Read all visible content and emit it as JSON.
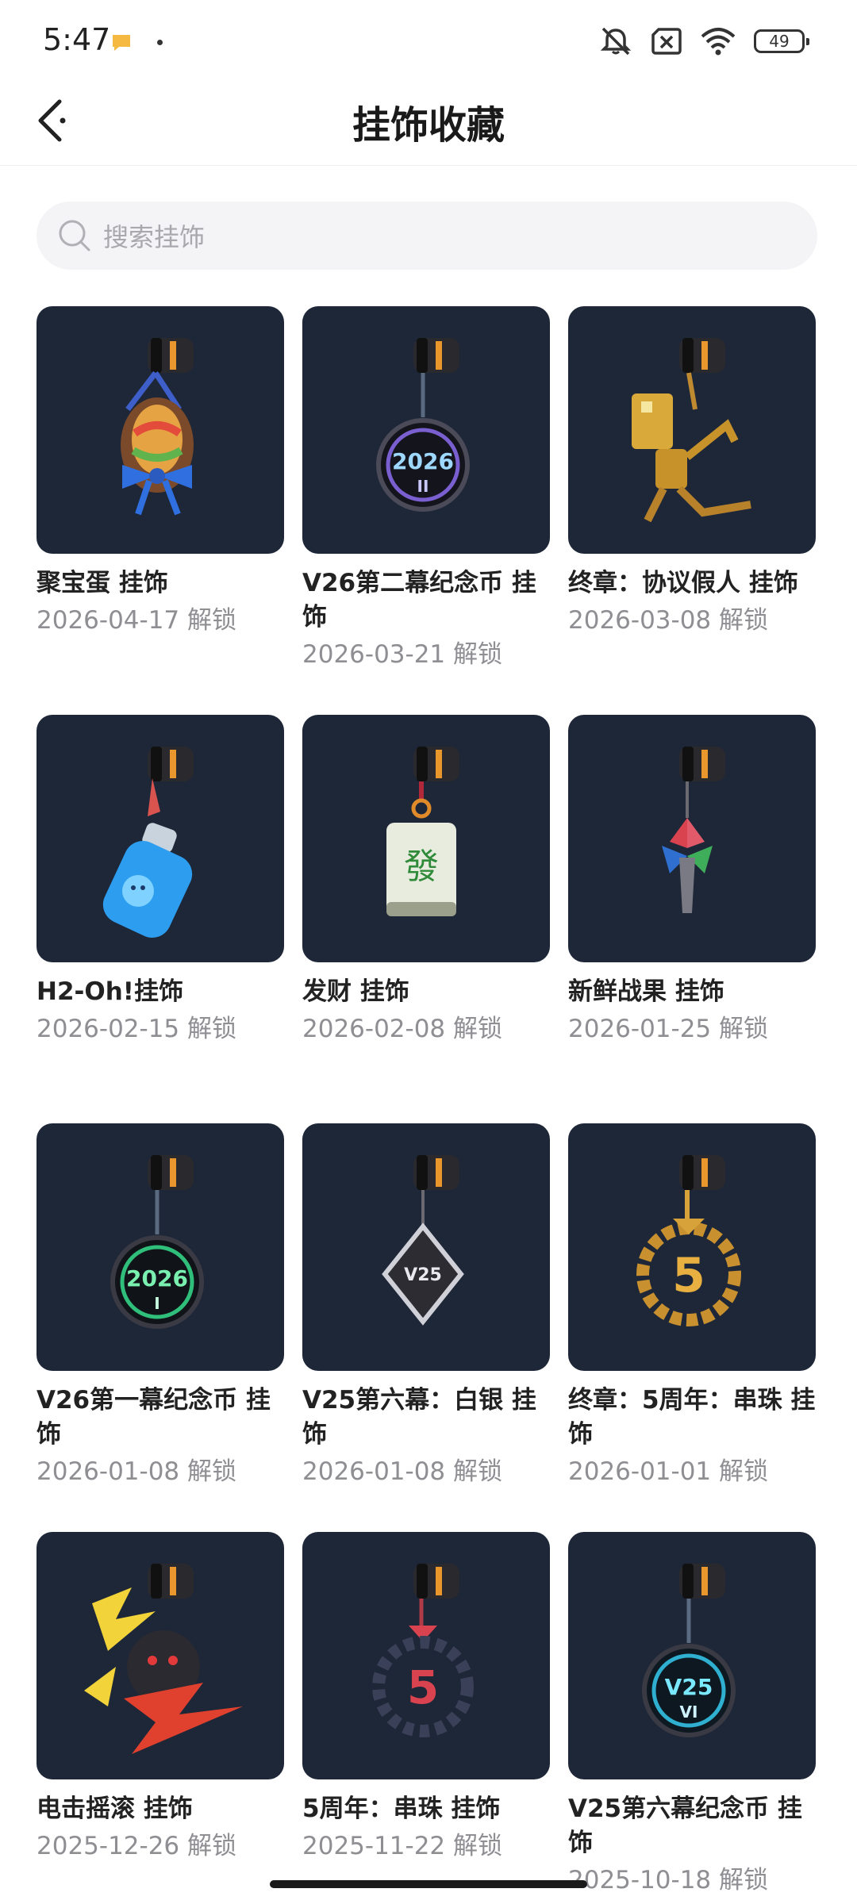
{
  "status_bar": {
    "time": "5:47",
    "battery": "49",
    "icons": [
      "notification-icon",
      "mute-icon",
      "sim-off-icon",
      "wifi-icon",
      "battery-icon"
    ]
  },
  "header": {
    "title": "挂饰收藏",
    "back_icon": "back-arrow-icon"
  },
  "search": {
    "placeholder": "搜索挂饰",
    "icon": "search-icon"
  },
  "items": [
    {
      "name": "聚宝蛋 挂饰",
      "date": "2026-04-17 解锁",
      "art": "egg"
    },
    {
      "name": "V26第二幕纪念币 挂饰",
      "date": "2026-03-21 解锁",
      "art": "coin-2026-ii"
    },
    {
      "name": "终章：协议假人 挂饰",
      "date": "2026-03-08 解锁",
      "art": "golden-dummy"
    },
    {
      "name": "H2-Oh!挂饰",
      "date": "2026-02-15 解锁",
      "art": "water-bottle"
    },
    {
      "name": "发财 挂饰",
      "date": "2026-02-08 解锁",
      "art": "mahjong-tile"
    },
    {
      "name": "新鲜战果 挂饰",
      "date": "2026-01-25 解锁",
      "art": "leaf-fruit"
    },
    {
      "name": "V26第一幕纪念币 挂饰",
      "date": "2026-01-08 解锁",
      "art": "coin-2026-i"
    },
    {
      "name": "V25第六幕：白银 挂饰",
      "date": "2026-01-08 解锁",
      "art": "silver-diamond"
    },
    {
      "name": "终章：5周年：串珠 挂饰",
      "date": "2026-01-01 解锁",
      "art": "gold-beads-5"
    },
    {
      "name": "电击摇滚 挂饰",
      "date": "2025-12-26 解锁",
      "art": "lightning"
    },
    {
      "name": "5周年：串珠 挂饰",
      "date": "2025-11-22 解锁",
      "art": "beads-5"
    },
    {
      "name": "V25第六幕纪念币 挂饰",
      "date": "2025-10-18 解锁",
      "art": "coin-v25-vi"
    }
  ],
  "colors": {
    "thumb_bg": "#1e2738",
    "date_text": "#8e8e93",
    "search_bg": "#f4f4f6"
  },
  "thumb_text": {
    "coin_2026": "2026",
    "coin_ii": "II",
    "coin_i": "I",
    "mahjong": "發",
    "v25": "V25",
    "vi": "VI",
    "five": "5"
  }
}
